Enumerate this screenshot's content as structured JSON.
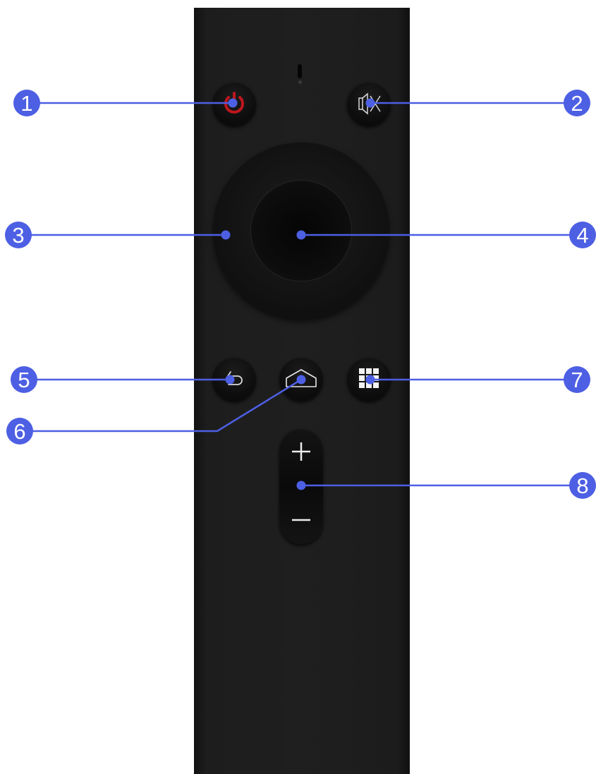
{
  "remote": {
    "color": "#1d1d1d",
    "buttons": [
      {
        "name": "power-button",
        "icon": "power-icon",
        "icon_color": "#c0161e"
      },
      {
        "name": "mute-button",
        "icon": "mute-icon"
      },
      {
        "name": "dpad-ring",
        "icon": "none"
      },
      {
        "name": "ok-button",
        "icon": "none"
      },
      {
        "name": "back-button",
        "icon": "back-arrow-icon"
      },
      {
        "name": "home-button",
        "icon": "home-icon"
      },
      {
        "name": "menu-button",
        "icon": "grid-menu-icon"
      },
      {
        "name": "volume-rocker",
        "icon": "plus-minus-icon"
      }
    ]
  },
  "callouts": {
    "color": "#4d5fe3",
    "labels": [
      "1",
      "2",
      "3",
      "4",
      "5",
      "6",
      "7",
      "8"
    ]
  }
}
